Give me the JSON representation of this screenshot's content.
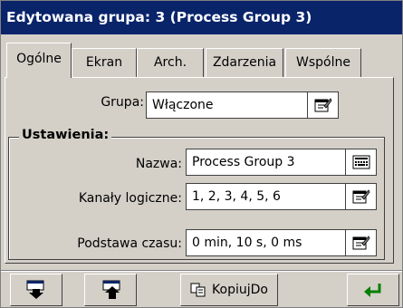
{
  "window": {
    "title": "Edytowana grupa: 3 (Process Group 3)"
  },
  "tabs": [
    {
      "label": "Ogólne",
      "active": true
    },
    {
      "label": "Ekran",
      "active": false
    },
    {
      "label": "Arch.",
      "active": false
    },
    {
      "label": "Zdarzenia",
      "active": false
    },
    {
      "label": "Wspólne",
      "active": false
    }
  ],
  "general": {
    "group_label": "Grupa:",
    "group_value": "Włączone",
    "settings_title": "Ustawienia:",
    "name_label": "Nazwa:",
    "name_value": "Process Group 3",
    "channels_label": "Kanały logiczne:",
    "channels_value": "1, 2, 3, 4, 5, 6",
    "timebase_label": "Podstawa czasu:",
    "timebase_value": "0 min, 10 s, 0 ms"
  },
  "toolbar": {
    "copy_label": "KopiujDo"
  },
  "colors": {
    "title_bg": "#0a246a",
    "accent_green": "#008000"
  }
}
